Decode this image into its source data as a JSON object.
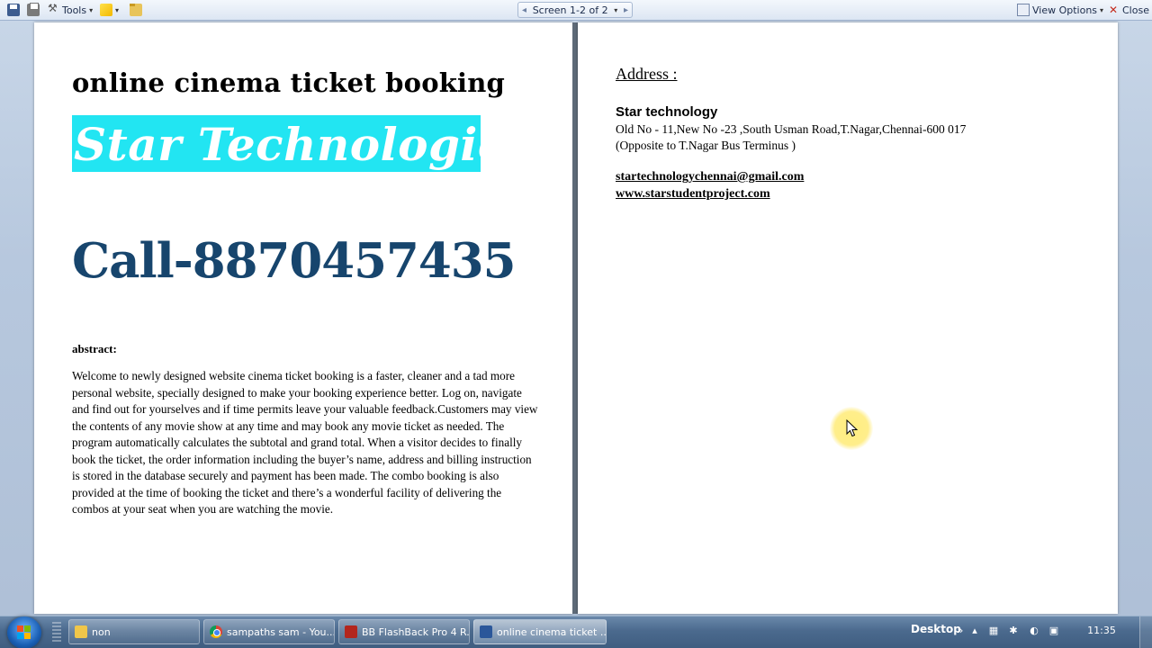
{
  "toolbar": {
    "tools_label": "Tools",
    "screen_label": "Screen 1-2 of 2",
    "view_options_label": "View Options",
    "close_label": "Close"
  },
  "page_left": {
    "title": "online cinema ticket booking",
    "brand": "Star Technologies",
    "call": "Call-8870457435",
    "abstract_heading": "abstract:",
    "abstract_body": "Welcome to newly designed website cinema ticket booking is a faster, cleaner and a tad more personal website, specially designed to make your booking experience better.  Log on, navigate and find out for yourselves and if time permits leave your valuable feedback.Customers may view the contents of any movie show at any time and may book any movie ticket as needed. The program automatically calculates the subtotal and grand total. When a visitor decides to finally book the ticket, the order information including the buyer’s name, address and billing instruction is stored in the database securely and payment has been made. The combo booking is also provided at the time of booking the ticket and there’s a wonderful facility of delivering the combos at your seat when you are watching the movie."
  },
  "page_right": {
    "address_heading": "Address :",
    "company": "Star technology",
    "address_line1": "Old No - 11,New No -23 ,South Usman Road,T.Nagar,Chennai-600 017",
    "address_line2": "(Opposite to T.Nagar Bus Terminus )",
    "email": "startechnologychennai@gmail.com",
    "website": "www.starstudentproject.com"
  },
  "taskbar": {
    "tasks": [
      {
        "label": "non",
        "icon": "folder-icon"
      },
      {
        "label": "sampaths sam - You...",
        "icon": "chrome-icon"
      },
      {
        "label": "BB FlashBack Pro 4 R...",
        "icon": "flashback-icon"
      },
      {
        "label": "online cinema ticket ...",
        "icon": "word-icon"
      }
    ],
    "desktop_label": "Desktop",
    "clock": "11:35"
  },
  "colors": {
    "brand_banner": "#22e5f2",
    "call_text": "#17456d"
  }
}
